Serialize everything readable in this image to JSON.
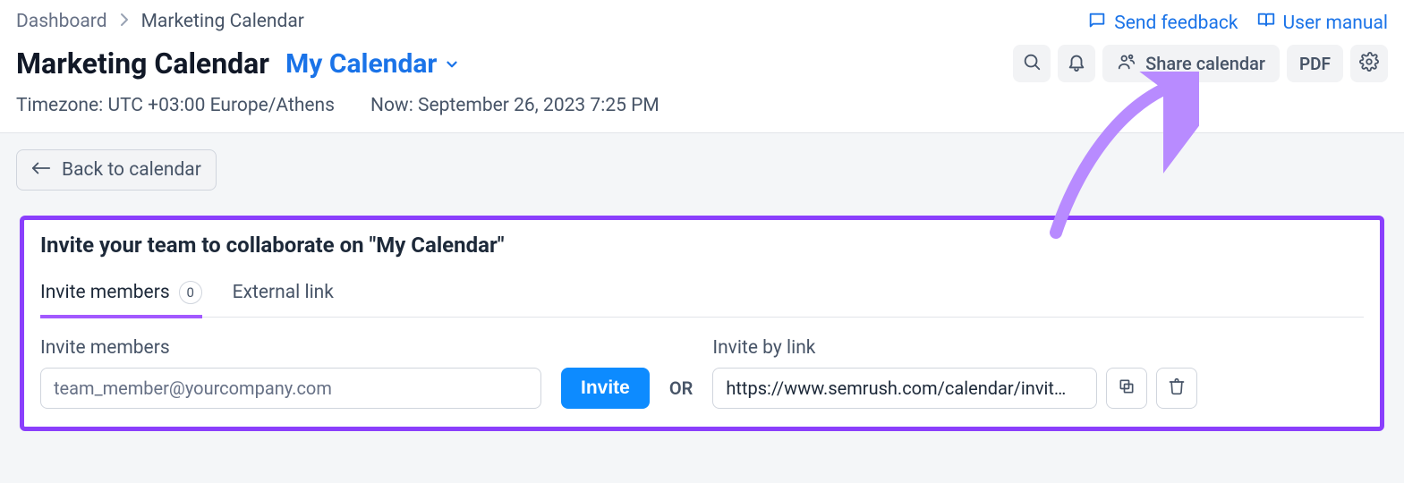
{
  "top_links": {
    "feedback_label": "Send feedback",
    "manual_label": "User manual"
  },
  "breadcrumb": {
    "root": "Dashboard",
    "current": "Marketing Calendar"
  },
  "header": {
    "title": "Marketing Calendar",
    "selected_calendar": "My Calendar",
    "share_label": "Share calendar",
    "pdf_label": "PDF",
    "timezone": "Timezone: UTC +03:00 Europe/Athens",
    "now": "Now: September 26, 2023 7:25 PM"
  },
  "back_label": "Back to calendar",
  "panel": {
    "title": "Invite your team to collaborate on \"My Calendar\"",
    "tabs": {
      "invite_label": "Invite members",
      "invite_count": "0",
      "external_label": "External link"
    },
    "form": {
      "invite_field_label": "Invite members",
      "invite_placeholder": "team_member@yourcompany.com",
      "invite_button": "Invite",
      "or": "OR",
      "link_field_label": "Invite by link",
      "link_value": "https://www.semrush.com/calendar/invit…"
    }
  }
}
